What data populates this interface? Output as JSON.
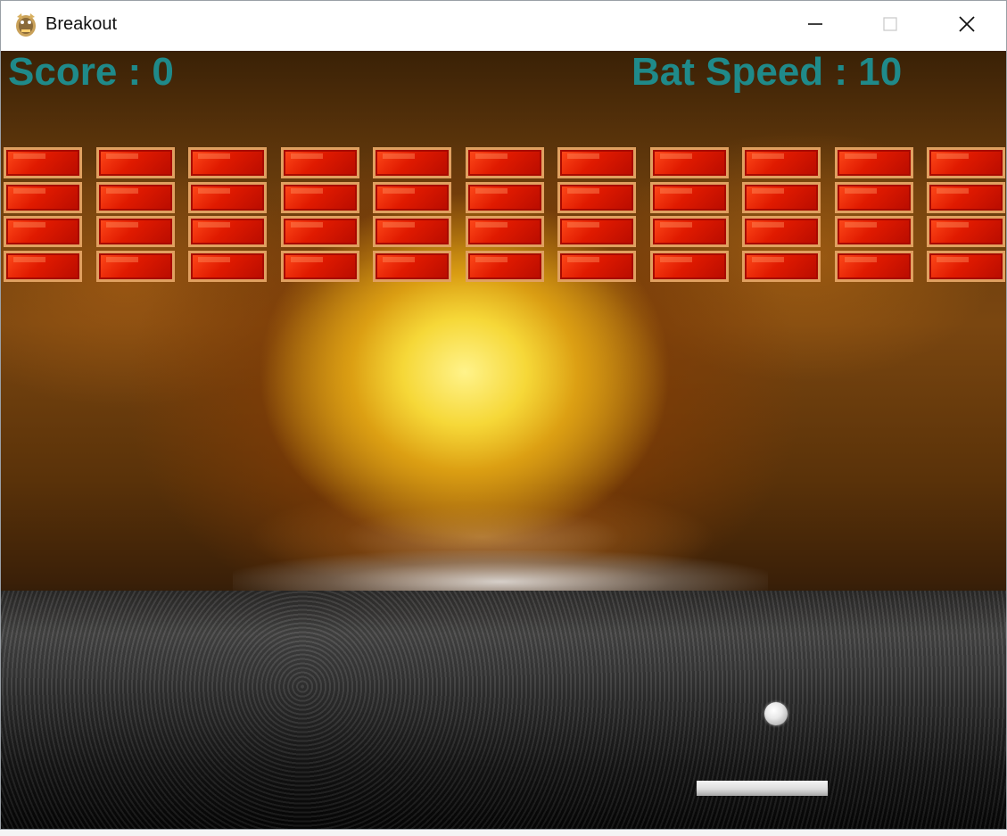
{
  "window": {
    "title": "Breakout"
  },
  "titlebar": {
    "icon": "pygame-snake-icon",
    "buttons": [
      "minimize-icon",
      "maximize-icon",
      "close-icon"
    ]
  },
  "hud": {
    "score_text": "Score : 0",
    "bat_speed_text": "Bat Speed : 10",
    "score": 0,
    "bat_speed": 10
  },
  "game": {
    "brick_rows": 4,
    "brick_columns": 11,
    "brick_color": "#e01a00",
    "brick_border_color": "#e0a060",
    "hud_color": "#1f8a8a"
  }
}
